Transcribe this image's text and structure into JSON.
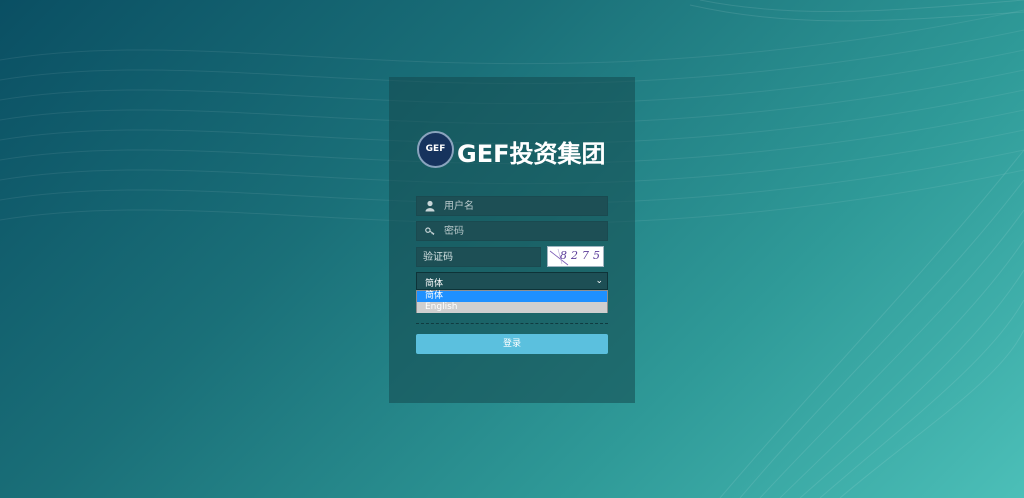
{
  "logo": {
    "emblem_text": "GEF",
    "brand_text": "GEF投资集团"
  },
  "form": {
    "username_placeholder": "用户名",
    "password_placeholder": "密码",
    "captcha_placeholder": "验证码",
    "captcha_code": "8275",
    "language": {
      "selected": "简体",
      "options": [
        "简体",
        "English"
      ]
    },
    "login_label": "登录"
  },
  "icons": {
    "username": "user-icon",
    "password": "key-icon",
    "dropdown": "chevron-down-icon"
  },
  "colors": {
    "login_button": "#5bc0de",
    "selected_option": "#1e90ff"
  }
}
